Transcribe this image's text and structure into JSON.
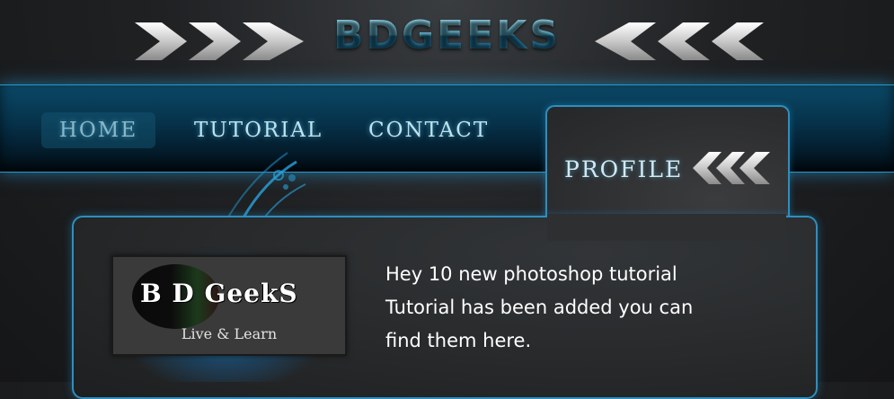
{
  "site": {
    "title": "BDGEEKS"
  },
  "nav": {
    "items": [
      {
        "label": "HOME"
      },
      {
        "label": "TUTORIAL"
      },
      {
        "label": "CONTACT"
      }
    ],
    "profile_label": "PROFILE"
  },
  "brand_box": {
    "name": "B D GeekS",
    "tagline": "Live & Learn"
  },
  "message": {
    "lines": [
      "Hey 10 new photoshop tutorial",
      "Tutorial has been added you can",
      "find them here."
    ]
  },
  "icons": {
    "header_left": "right-chevrons-icon",
    "header_right": "left-chevrons-icon",
    "profile": "left-chevrons-icon"
  },
  "colors": {
    "accent": "#2a97c8",
    "title": "#58b6d6",
    "background": "#1f2123"
  }
}
